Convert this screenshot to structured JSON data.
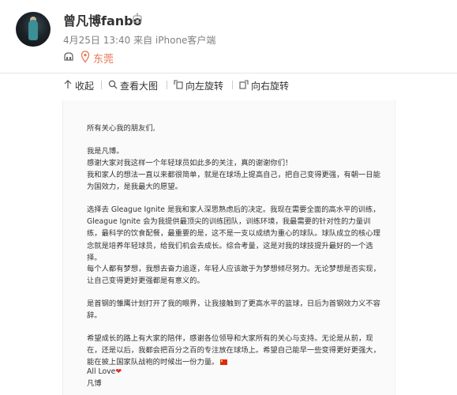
{
  "post": {
    "user_name": "曾凡博fanbo",
    "meta": "4月25日 13:40 来自 iPhone客户端",
    "location": "东莞"
  },
  "toolbar": {
    "collapse": "收起",
    "view_large": "查看大图",
    "rotate_left": "向左旋转",
    "rotate_right": "向右旋转"
  },
  "letter": {
    "greeting": "所有关心我的朋友们,",
    "p1": [
      "我是凡博。",
      "感谢大家对我这样一个年轻球员如此多的关注，真的谢谢你们！",
      "我和家人的想法一直以来都很简单，就是在球场上提高自己，把自己变得更强，有朝一日能为国效力，是我最大的愿望。"
    ],
    "p2": [
      "选择去 Gleague Ignite 是我和家人深思熟虑后的决定。我现在需要全面的高水平的训练，Gleague Ignite 会为我提供最顶尖的训练团队，训练环境，我最需要的针对性的力量训练，最科学的饮食配餐，最重要的是，这不是一支以成绩为重心的球队。球队成立的核心理念就是培养年轻球员，给我们机会去成长。综合考量，这是对我的球技提升最好的一个选择。",
      "每个人都有梦想，我想去奋力追逐，年轻人应该敢于为梦想倾尽努力。无论梦想是否实现，让自己变得更好更强都是有意义的。"
    ],
    "p3": "是首钢的雏鹰计划打开了我的眼界，让我接触到了更高水平的篮球，日后为首钢效力义不容辞。",
    "p4": "希望成长的路上有大家的陪伴，感谢各位领导和大家所有的关心与支持。无论是从前，现在，还是以后，我都会把百分之百的专注放在球场上。希望自己能早一些变得更好更强大，能在披上国家队战袍的时候出一份力量。",
    "signoff": "All Love",
    "signature": "凡博"
  }
}
